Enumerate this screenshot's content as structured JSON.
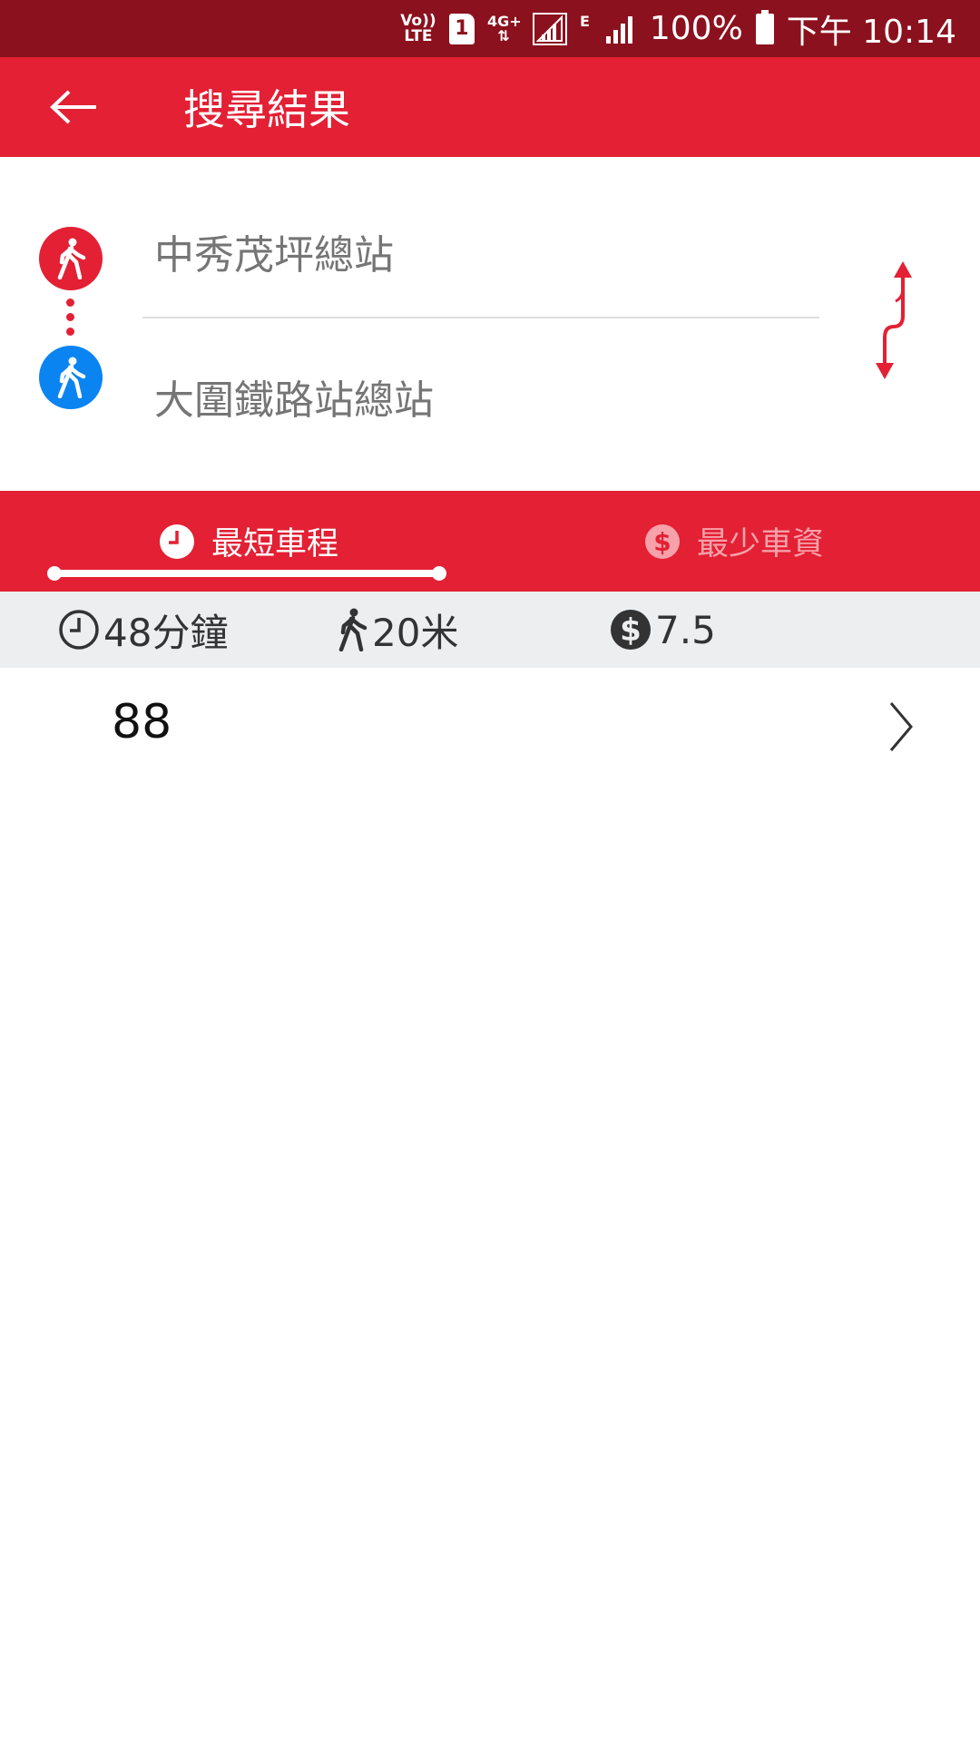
{
  "status_bar": {
    "volte": "Vo))\nLTE",
    "sim": "1",
    "network": "4G+",
    "network_e": "E",
    "battery": "100%",
    "time": "下午 10:14"
  },
  "app_bar": {
    "title": "搜尋結果"
  },
  "route": {
    "origin": "中秀茂坪總站",
    "destination": "大圍鐵路站總站"
  },
  "tabs": [
    {
      "label": "最短車程",
      "selected": true
    },
    {
      "label": "最少車資",
      "selected": false
    }
  ],
  "summary": {
    "duration": "48分鐘",
    "walk": "20米",
    "fare": "7.5"
  },
  "results": [
    {
      "route_number": "88"
    }
  ],
  "colors": {
    "status_bar": "#8b111e",
    "primary": "#e32034",
    "origin_marker": "#e32034",
    "destination_marker": "#0a84f0",
    "summary_bg": "#eceef0"
  }
}
